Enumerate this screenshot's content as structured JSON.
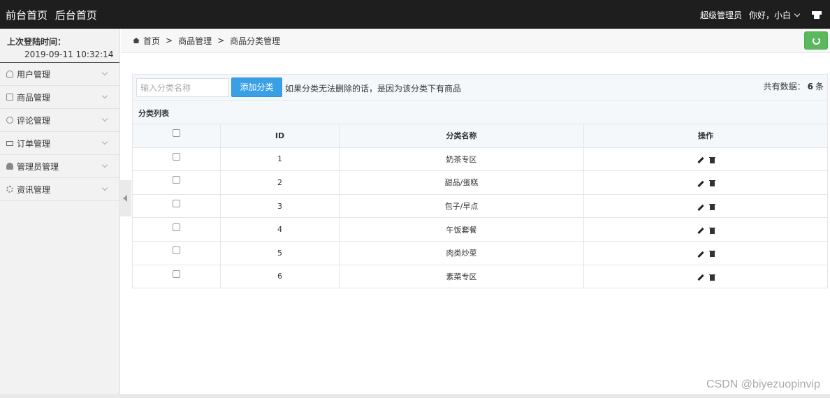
{
  "topbar": {
    "nav": [
      "前台首页",
      "后台首页"
    ],
    "role": "超级管理员",
    "greeting": "你好，小白"
  },
  "sidebar": {
    "login_label": "上次登陆时间：",
    "login_time": "2019-09-11 10:32:14",
    "items": [
      {
        "label": "用户管理",
        "icon": "user-icon"
      },
      {
        "label": "商品管理",
        "icon": "bag-icon"
      },
      {
        "label": "评论管理",
        "icon": "chat-icon"
      },
      {
        "label": "订单管理",
        "icon": "card-icon"
      },
      {
        "label": "管理员管理",
        "icon": "person-icon"
      },
      {
        "label": "资讯管理",
        "icon": "gear-icon"
      }
    ]
  },
  "breadcrumb": [
    "首页",
    "商品管理",
    "商品分类管理"
  ],
  "toolbar": {
    "search_placeholder": "输入分类名称",
    "search_value": "",
    "add_label": "添加分类",
    "hint": "如果分类无法删除的话，是因为该分类下有商品",
    "total_prefix": "共有数据：",
    "total_count": "6",
    "total_suffix": "条"
  },
  "table": {
    "title": "分类列表",
    "headers": [
      "ID",
      "分类名称",
      "操作"
    ],
    "rows": [
      {
        "id": "1",
        "name": "奶茶专区"
      },
      {
        "id": "2",
        "name": "甜品/蛋糕"
      },
      {
        "id": "3",
        "name": "包子/早点"
      },
      {
        "id": "4",
        "name": "午饭套餐"
      },
      {
        "id": "5",
        "name": "肉类炒菜"
      },
      {
        "id": "6",
        "name": "素菜专区"
      }
    ]
  },
  "watermark": "CSDN @biyezuopinvip",
  "colors": {
    "topbar": "#1e1e1e",
    "add_button": "#3aa0e6",
    "refresh_button": "#5cb85c"
  }
}
